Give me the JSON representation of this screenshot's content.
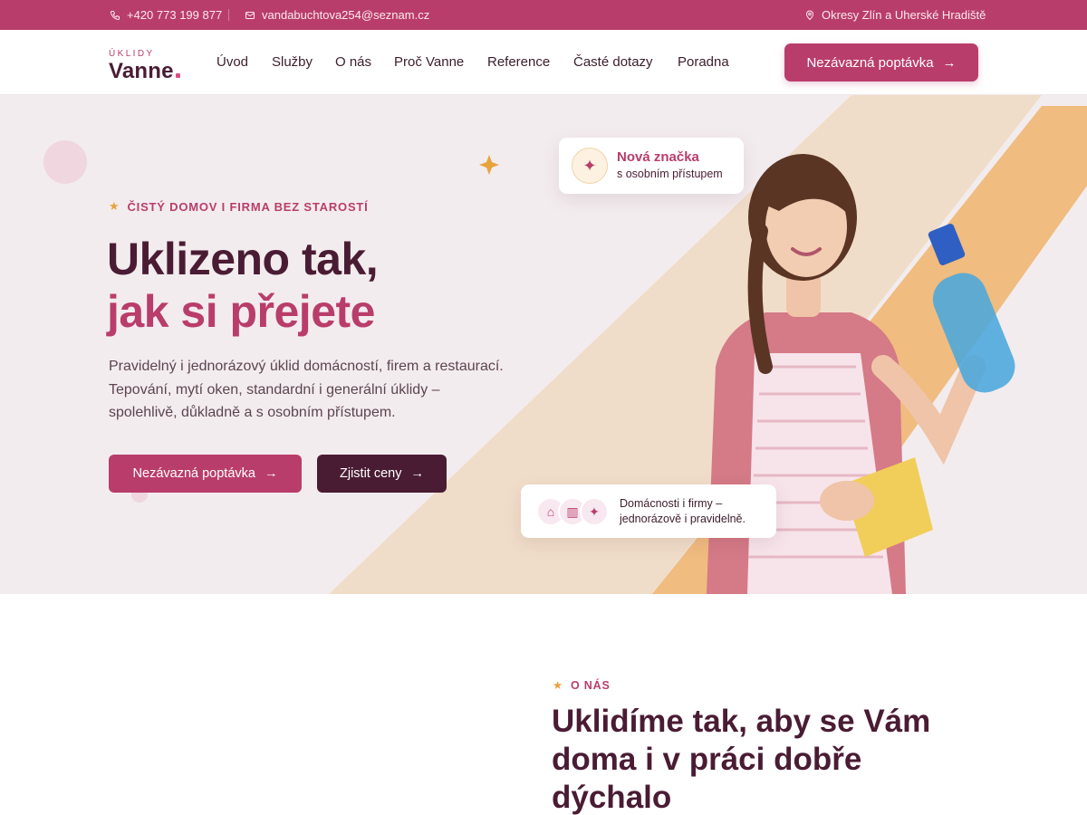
{
  "topbar": {
    "phone": "+420 773 199 877",
    "email": "vandabuchtova254@seznam.cz",
    "location": "Okresy Zlín a Uherské Hradiště",
    "icons": [
      "phone-icon",
      "mail-icon",
      "location-pin-icon"
    ]
  },
  "header": {
    "logo_small": "ÚKLIDY",
    "logo_big": "Vanne",
    "nav": [
      "Úvod",
      "Služby",
      "O nás",
      "Proč Vanne",
      "Reference",
      "Časté dotazy",
      "Poradna"
    ],
    "cta_label": "Nezávazná poptávka"
  },
  "hero": {
    "eyebrow": "ČISTÝ DOMOV I FIRMA BEZ STAROSTÍ",
    "title_line1": "Uklizeno tak,",
    "title_line2": "jak si přejete",
    "lead": "Pravidelný i jednorázový úklid domácností, firem a restaurací. Tepování, mytí oken, standardní i generální úklidy – spolehlivě, důkladně a s osobním přístupem.",
    "primary_button": "Nezávazná poptávka",
    "secondary_button": "Zjistit ceny",
    "badge_title": "Nová značka",
    "badge_subtitle": "s osobním přístupem",
    "info_line1": "Domácnosti i firmy –",
    "info_line2": "jednorázově i pravidelně."
  },
  "about": {
    "eyebrow": "O NÁS",
    "title": "Uklidíme tak, aby se Vám doma i v práci dobře dýchalo"
  },
  "colors": {
    "brand": "#b93d6a",
    "dark": "#4a1c34",
    "accent": "#e8a33d",
    "hero_bg": "#f3ecee"
  }
}
